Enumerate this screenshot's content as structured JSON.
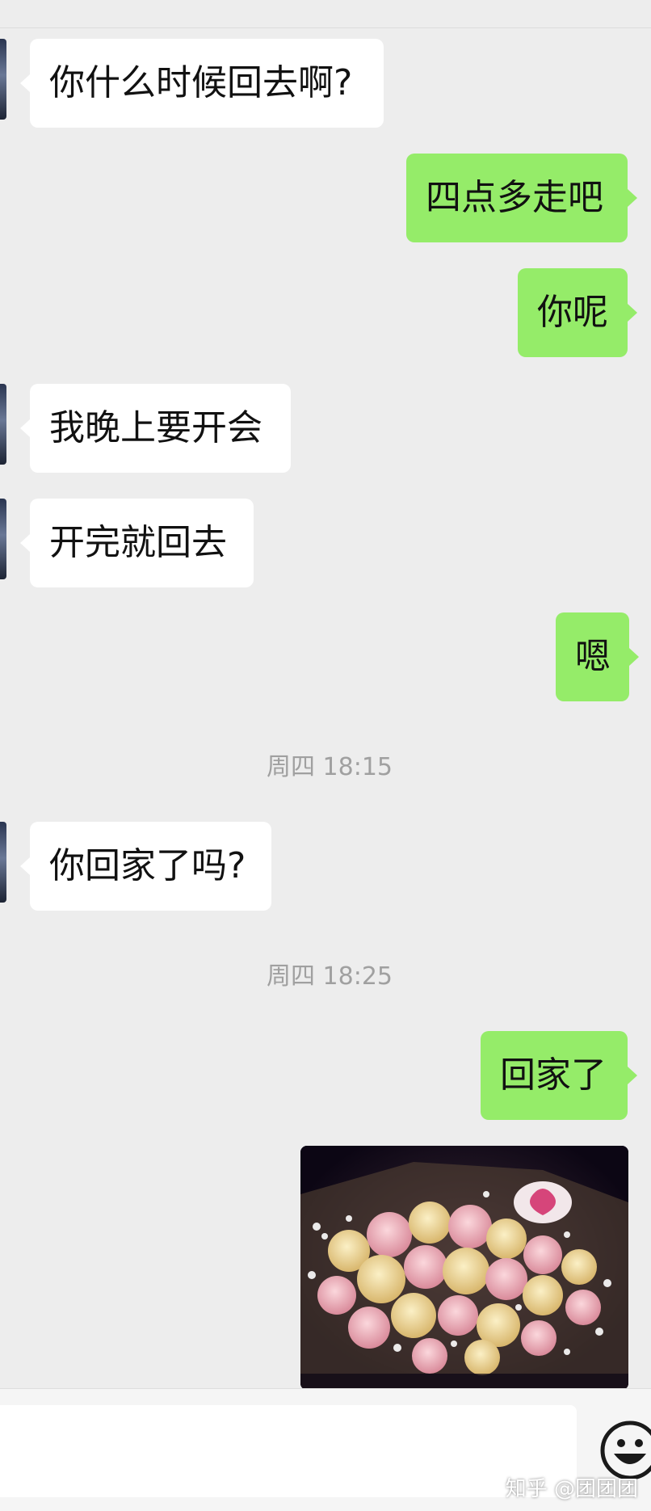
{
  "messages": [
    {
      "side": "left",
      "text": "你什么时候回去啊?"
    },
    {
      "side": "right",
      "text": "四点多走吧"
    },
    {
      "side": "right",
      "text": "你呢"
    },
    {
      "side": "left",
      "text": "我晚上要开会"
    },
    {
      "side": "left",
      "text": "开完就回去"
    },
    {
      "side": "right",
      "text": "嗯"
    },
    {
      "side": "left",
      "text": "你回家了吗?"
    },
    {
      "side": "right",
      "text": "回家了"
    }
  ],
  "timestamps": [
    "周四 18:15",
    "周四 18:25"
  ],
  "photo": {
    "label": "",
    "alt": "flower-bouquet-photo"
  },
  "input": {
    "value": "",
    "placeholder": ""
  },
  "icons": {
    "emoji": "smiley-face-icon"
  },
  "watermark": "知乎 @团团团",
  "colors": {
    "background": "#ededed",
    "incoming_bubble": "#ffffff",
    "outgoing_bubble": "#95ec69",
    "timestamp": "#a0a0a0"
  }
}
